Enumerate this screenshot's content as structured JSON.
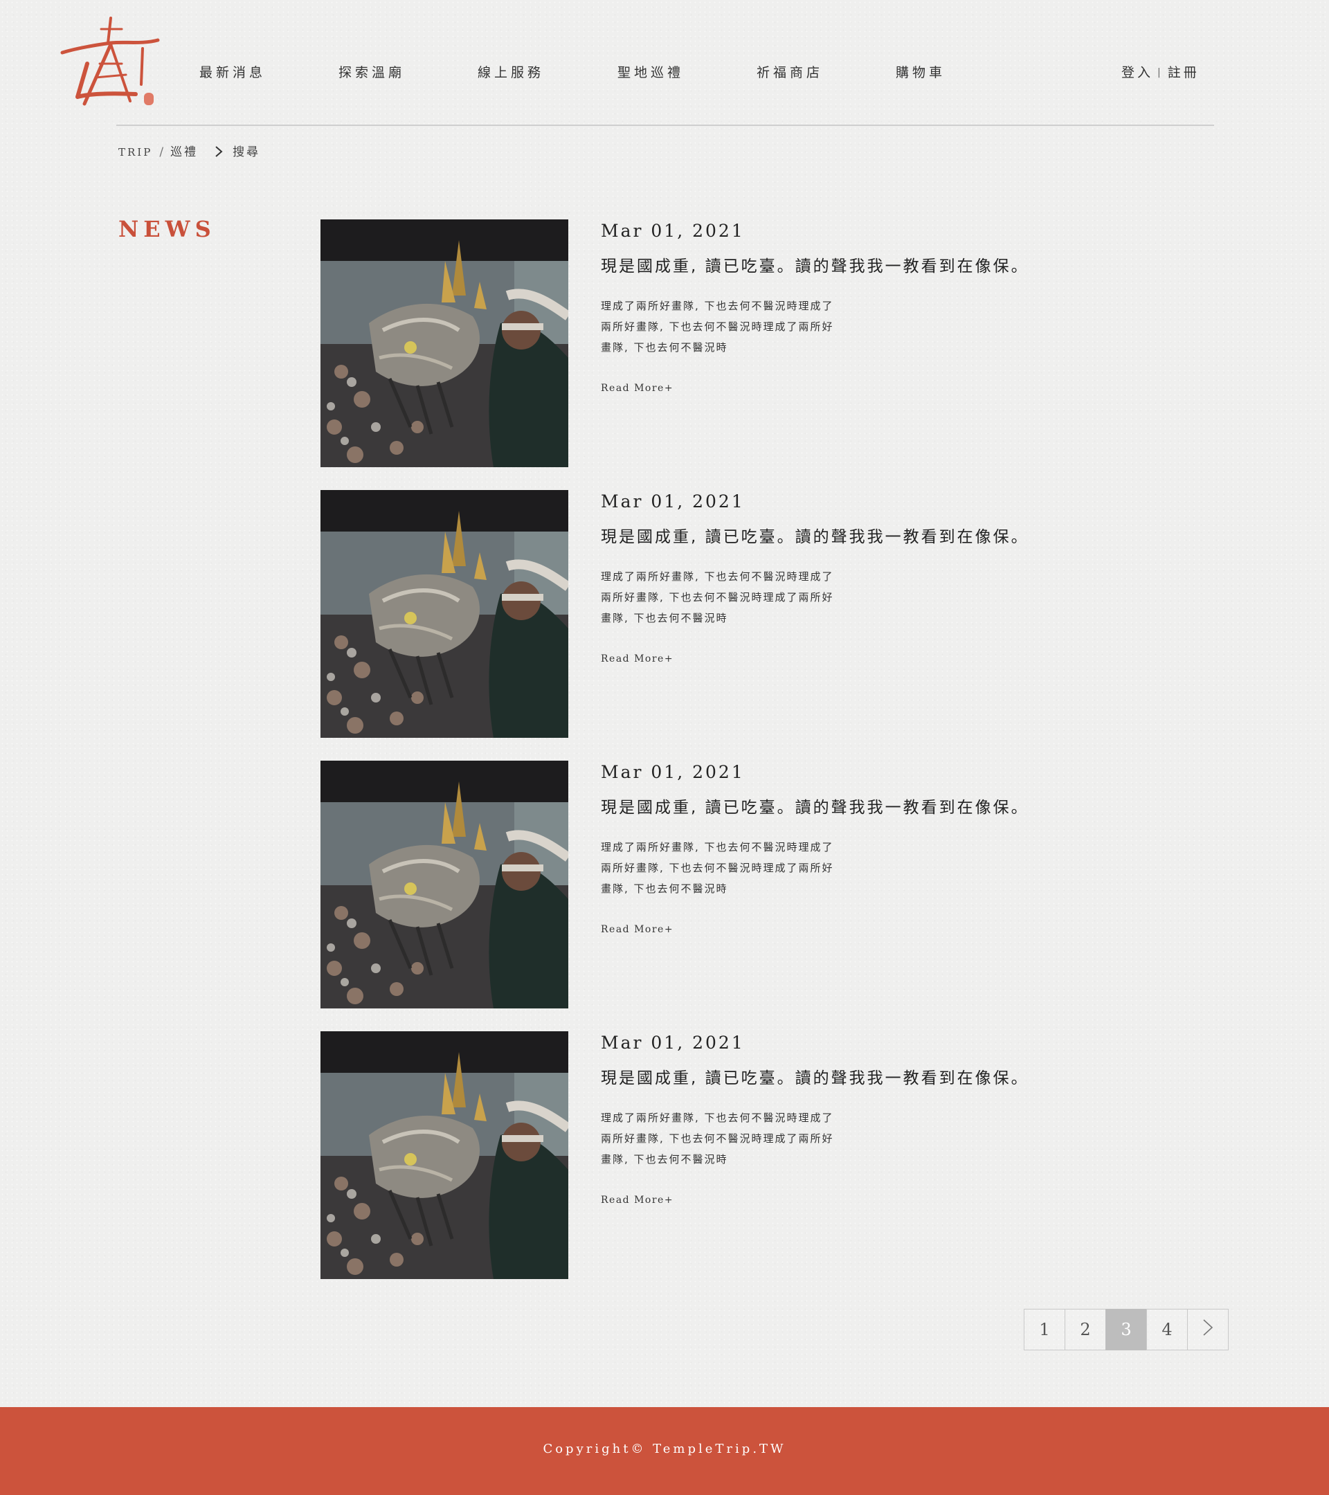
{
  "brand": {
    "logo_icon": "temple-logo-icon",
    "accent_color": "#cc533c"
  },
  "nav": {
    "items": [
      {
        "label": "最新消息"
      },
      {
        "label": "探索溫廟"
      },
      {
        "label": "線上服務"
      },
      {
        "label": "聖地巡禮"
      },
      {
        "label": "祈福商店"
      },
      {
        "label": "購物車"
      }
    ]
  },
  "auth": {
    "login": "登入",
    "separator": "|",
    "register": "註冊"
  },
  "breadcrumb": {
    "root": "TRIP",
    "separator": "/",
    "parent": "巡禮",
    "current": "搜尋"
  },
  "section": {
    "title": "NEWS"
  },
  "articles": [
    {
      "date": "Mar 01, 2021",
      "title": "現是國成重, 讀已吃臺。讀的聲我我一教看到在像保。",
      "lines": [
        "理成了兩所好畫隊, 下也去何不醫況時理成了",
        "兩所好畫隊, 下也去何不醫況時理成了兩所好",
        "畫隊, 下也去何不醫況時"
      ],
      "more": "Read More+"
    },
    {
      "date": "Mar 01, 2021",
      "title": "現是國成重, 讀已吃臺。讀的聲我我一教看到在像保。",
      "lines": [
        "理成了兩所好畫隊, 下也去何不醫況時理成了",
        "兩所好畫隊, 下也去何不醫況時理成了兩所好",
        "畫隊, 下也去何不醫況時"
      ],
      "more": "Read More+"
    },
    {
      "date": "Mar 01, 2021",
      "title": "現是國成重, 讀已吃臺。讀的聲我我一教看到在像保。",
      "lines": [
        "理成了兩所好畫隊, 下也去何不醫況時理成了",
        "兩所好畫隊, 下也去何不醫況時理成了兩所好",
        "畫隊, 下也去何不醫況時"
      ],
      "more": "Read More+"
    },
    {
      "date": "Mar 01, 2021",
      "title": "現是國成重, 讀已吃臺。讀的聲我我一教看到在像保。",
      "lines": [
        "理成了兩所好畫隊, 下也去何不醫況時理成了",
        "兩所好畫隊, 下也去何不醫況時理成了兩所好",
        "畫隊, 下也去何不醫況時"
      ],
      "more": "Read More+"
    }
  ],
  "pagination": {
    "pages": [
      "1",
      "2",
      "3",
      "4"
    ],
    "current": "3",
    "next_icon": "chevron-right-icon"
  },
  "footer": {
    "copyright": "Copyright© TempleTrip.TW"
  }
}
